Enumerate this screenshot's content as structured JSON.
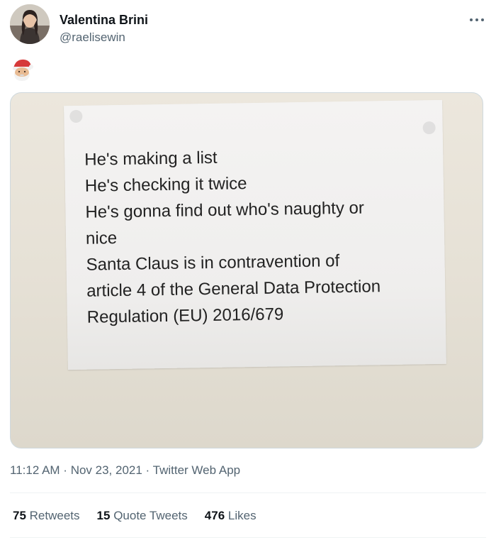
{
  "user": {
    "name": "Valentina Brini",
    "handle": "@raelisewin"
  },
  "tweet": {
    "emoji_icon": "santa-claus-emoji",
    "media_text_lines": [
      "He's making a list",
      "He's checking it twice",
      "He's gonna find out who's naughty or",
      "nice",
      "Santa Claus is in contravention of",
      "article 4 of the General Data Protection",
      "Regulation (EU) 2016/679"
    ]
  },
  "meta": {
    "time": "11:12 AM",
    "sep1": " · ",
    "date": "Nov 23, 2021",
    "sep2": " · ",
    "app": "Twitter Web App"
  },
  "stats": {
    "retweets_count": "75",
    "retweets_label": "Retweets",
    "quotes_count": "15",
    "quotes_label": "Quote Tweets",
    "likes_count": "476",
    "likes_label": "Likes"
  },
  "colors": {
    "primary_text": "#0f1419",
    "secondary_text": "#536471",
    "divider": "#eff3f4"
  }
}
